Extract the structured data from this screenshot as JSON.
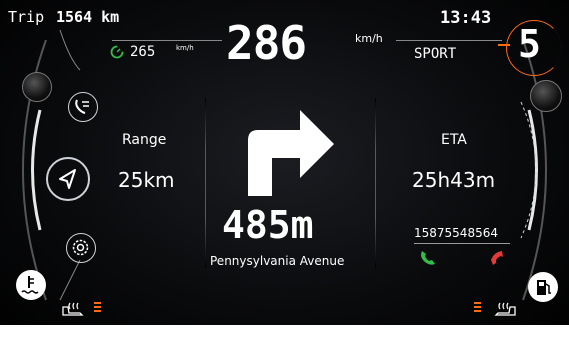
{
  "header": {
    "trip_label": "Trip",
    "trip_value": "1564 km",
    "clock": "13:43"
  },
  "speed": {
    "value": "286",
    "unit": "km/h",
    "limit_value": "265",
    "limit_unit": "km/h",
    "mode": "SPORT",
    "gear": "5"
  },
  "left_panel": {
    "range_label": "Range",
    "range_value": "25km",
    "icons": [
      "phone-list-icon",
      "navigation-icon",
      "settings-icon",
      "coolant-temp-icon",
      "seat-heat-icon"
    ]
  },
  "navigation": {
    "distance": "485m",
    "street": "Pennysylvania Avenue",
    "direction": "turn-right"
  },
  "right_panel": {
    "eta_label": "ETA",
    "eta_value": "25h43m",
    "phone_number": "15875548564",
    "icons": [
      "call-accept-icon",
      "call-decline-icon",
      "fuel-icon",
      "seat-heat-icon"
    ]
  },
  "colors": {
    "accent_orange": "#ff6a13",
    "call_green": "#2fbf4a",
    "call_red": "#e03a3a",
    "text": "#ffffff"
  }
}
